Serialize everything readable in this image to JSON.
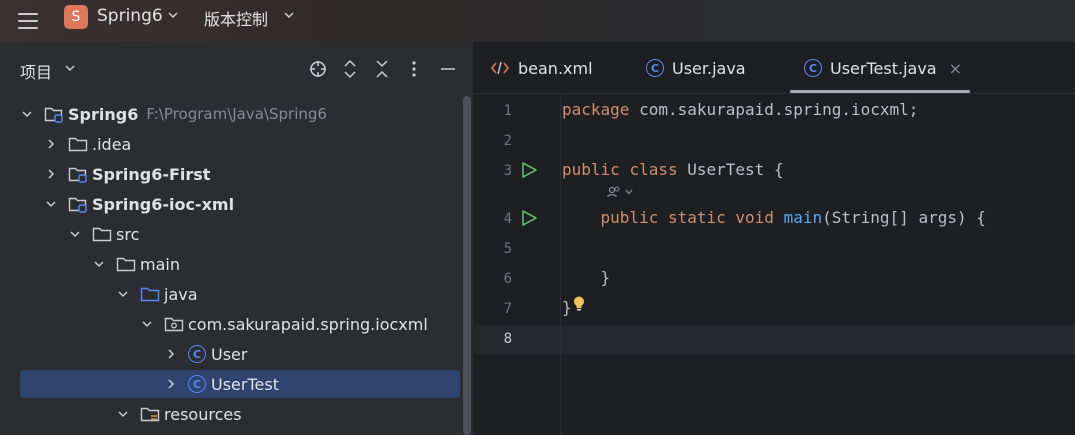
{
  "titlebar": {
    "project_badge": "S",
    "project_name": "Spring6",
    "vcs_label": "版本控制",
    "badge_color": "#e0765a"
  },
  "project_panel": {
    "title": "项目",
    "tools": [
      "locate-icon",
      "expand-icon",
      "collapse-icon",
      "more-icon",
      "minimize-icon"
    ]
  },
  "tree": [
    {
      "label": "Spring6",
      "path": "F:\\Program\\Java\\Spring6",
      "bold": true,
      "expanded": true,
      "icon": "module-folder-icon"
    },
    {
      "label": ".idea",
      "expanded": false,
      "icon": "folder-icon"
    },
    {
      "label": "Spring6-First",
      "bold": true,
      "expanded": false,
      "icon": "module-folder-icon"
    },
    {
      "label": "Spring6-ioc-xml",
      "bold": true,
      "expanded": true,
      "icon": "module-folder-icon"
    },
    {
      "label": "src",
      "expanded": true,
      "icon": "folder-icon"
    },
    {
      "label": "main",
      "expanded": true,
      "icon": "folder-icon"
    },
    {
      "label": "java",
      "expanded": true,
      "icon": "source-folder-icon"
    },
    {
      "label": "com.sakurapaid.spring.iocxml",
      "expanded": true,
      "icon": "package-icon"
    },
    {
      "label": "User",
      "expanded": false,
      "icon": "class-icon"
    },
    {
      "label": "UserTest",
      "expanded": false,
      "icon": "class-icon",
      "selected": true
    },
    {
      "label": "resources",
      "expanded": true,
      "icon": "resources-folder-icon"
    }
  ],
  "tabs": [
    {
      "label": "bean.xml",
      "icon": "xml-icon"
    },
    {
      "label": "User.java",
      "icon": "class-icon"
    },
    {
      "label": "UserTest.java",
      "icon": "class-icon",
      "active": true,
      "close": "×"
    }
  ],
  "editor": {
    "line_numbers": [
      "1",
      "2",
      "3",
      "4",
      "5",
      "6",
      "7",
      "8"
    ],
    "current_line": "8",
    "code": {
      "l1_kw": "package",
      "l1_rest": " com.sakurapaid.spring.iocxml;",
      "l3_kw1": "public",
      "l3_kw2": "class",
      "l3_rest": " UserTest {",
      "l4_indent": "    ",
      "l4_kw1": "public",
      "l4_kw2": "static",
      "l4_kw3": "void",
      "l4_fn": "main",
      "l4_rest": "(String[] args) {",
      "l6": "    }",
      "l7": "}"
    }
  },
  "colors": {
    "keyword": "#cf8e6d",
    "function": "#56a8f5",
    "class_badge": "#548af7",
    "run": "#5fb865",
    "selection": "#2e436e"
  }
}
